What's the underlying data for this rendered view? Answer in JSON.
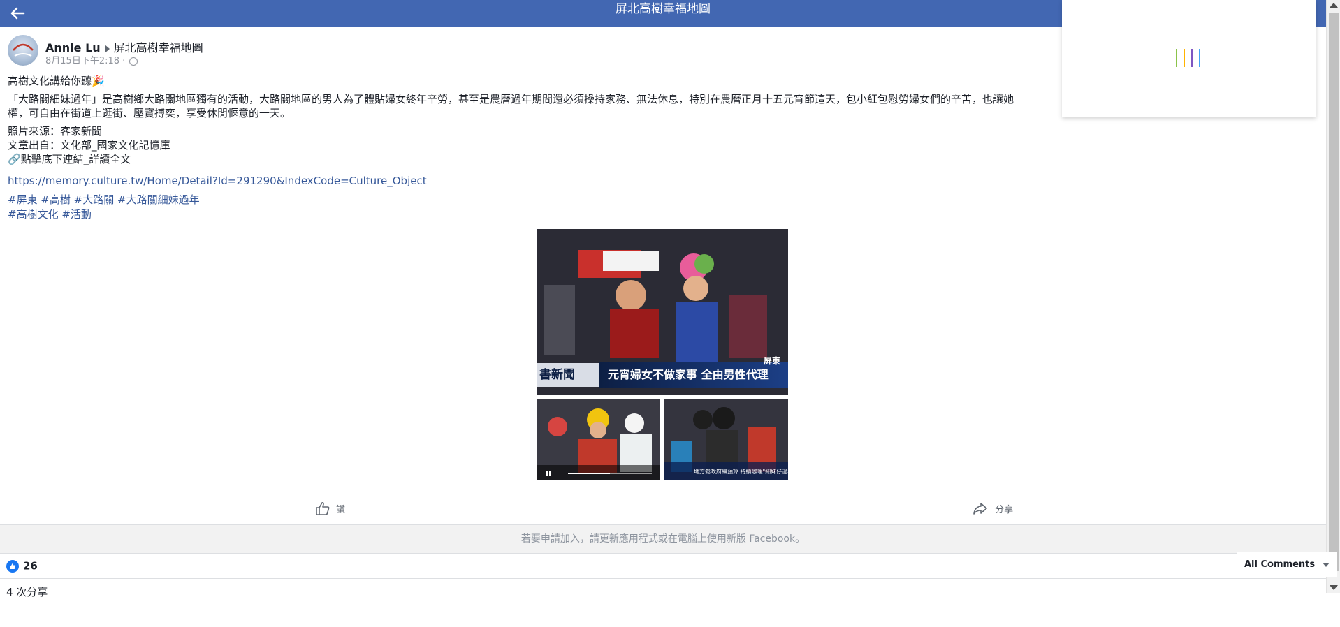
{
  "header": {
    "title": "屏北高樹幸福地圖"
  },
  "post": {
    "author": "Annie Lu",
    "group": "屏北高樹幸福地圖",
    "timestamp": "8月15日下午2:18",
    "privacy_separator": "·",
    "lines": {
      "line1": "高樹文化講給你聽🎉",
      "line2": "「大路關細妹過年」是高樹鄉大路關地區獨有的活動，大路關地區的男人為了體貼婦女終年辛勞，甚至是農曆過年期間還必須操持家務、無法休息，特別在農曆正月十五元宵節這天，包小紅包慰勞婦女們的辛苦，也讓她",
      "line3": "權，可自由在街道上逛街、壓寶搏奕，享受休閒愜意的一天。",
      "line4": "照片來源：客家新聞",
      "line5": "文章出自：文化部_國家文化記憶庫",
      "line6": "🔗點擊底下連結_詳讀全文"
    },
    "link": "https://memory.culture.tw/Home/Detail?Id=291290&IndexCode=Culture_Object",
    "tags_line1": "#屏東 #高樹 #大路關 #大路關細妹過年",
    "tags_line2": "#高樹文化 #活動",
    "photo_main": {
      "banner_text": "元宵婦女不做家事 全由男性代理",
      "channel_text": "書新聞",
      "corner_text": "屏東"
    },
    "photo_small_right_caption": "地方鬆政府編預算 持續辦理\"細妹仔過年\""
  },
  "actions": {
    "like_label": "讚",
    "share_label": "分享"
  },
  "notice": "若要申請加入，請更新應用程式或在電腦上使用新版 Facebook。",
  "reactions": {
    "like_count": "26"
  },
  "comments_filter": "All Comments",
  "share_count_text": "4 次分享",
  "colors": {
    "header_bg": "#4267b2",
    "link": "#365899",
    "muted": "#90949c"
  },
  "icons": {
    "back": "back-arrow-icon",
    "like": "thumbs-up-icon",
    "share": "share-arrow-icon",
    "privacy": "globe-icon"
  }
}
